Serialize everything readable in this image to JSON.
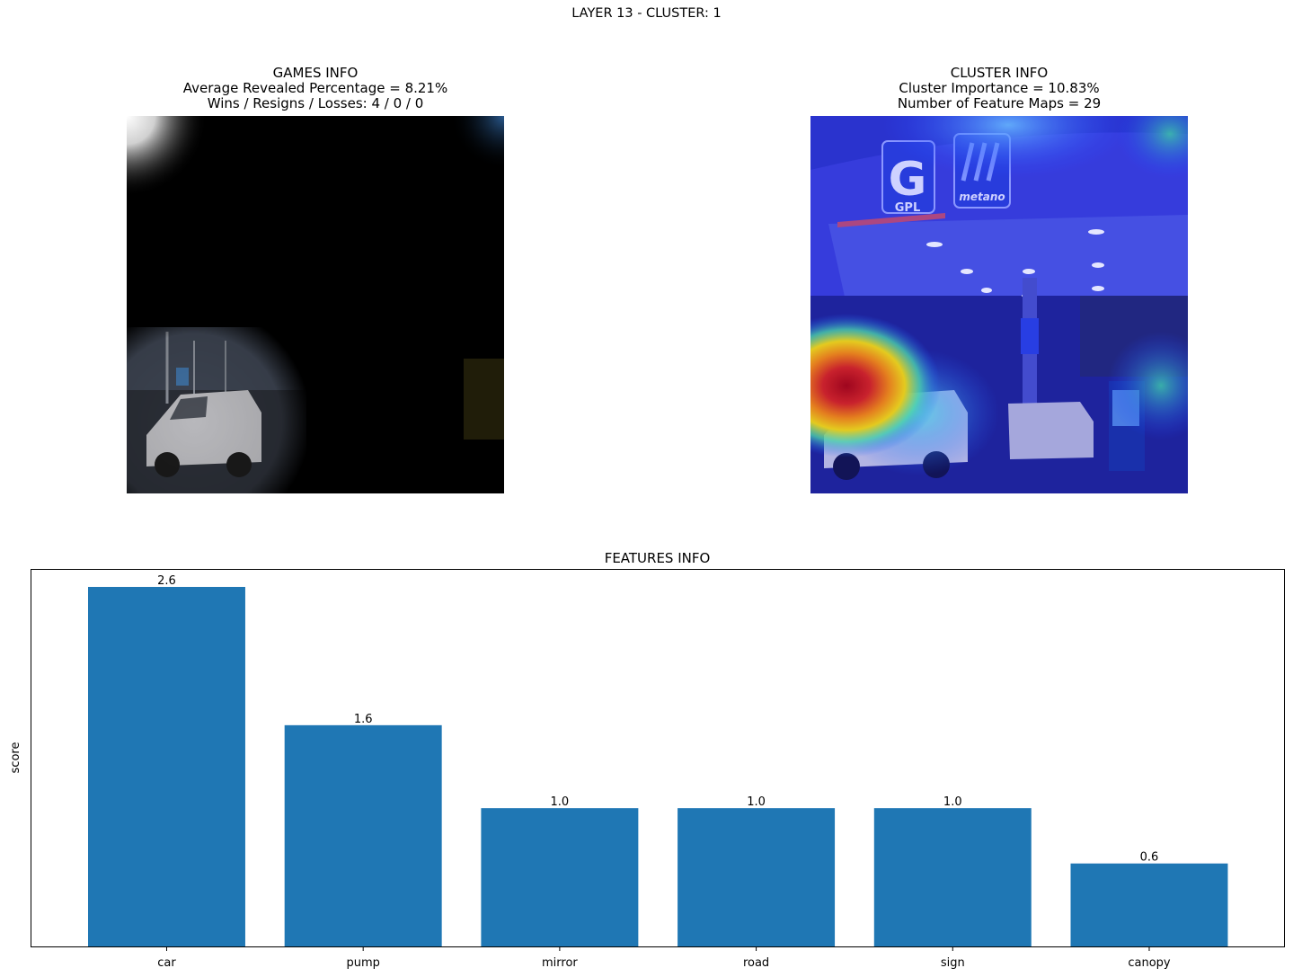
{
  "suptitle": "LAYER 13 - CLUSTER: 1",
  "games_panel": {
    "title": "GAMES INFO",
    "line1": "Average Revealed Percentage = 8.21%",
    "line2": "Wins / Resigns / Losses: 4 / 0 / 0"
  },
  "cluster_panel": {
    "title": "CLUSTER INFO",
    "line1": "Cluster Importance = 10.83%",
    "line2": "Number of Feature Maps = 29"
  },
  "image_text": {
    "sign_g": "G",
    "sign_gpl": "GPL",
    "sign_metano": "metano"
  },
  "chart_data": {
    "type": "bar",
    "title": "FEATURES INFO",
    "xlabel": "",
    "ylabel": "score",
    "categories": [
      "car",
      "pump",
      "mirror",
      "road",
      "sign",
      "canopy"
    ],
    "values": [
      2.6,
      1.6,
      1.0,
      1.0,
      1.0,
      0.6
    ],
    "value_labels": [
      "2.6",
      "1.6",
      "1.0",
      "1.0",
      "1.0",
      "0.6"
    ],
    "ylim": [
      0,
      2.73
    ],
    "bar_color": "#1f77b4",
    "grid": false,
    "legend": "none",
    "y_ticks_shown": false
  }
}
